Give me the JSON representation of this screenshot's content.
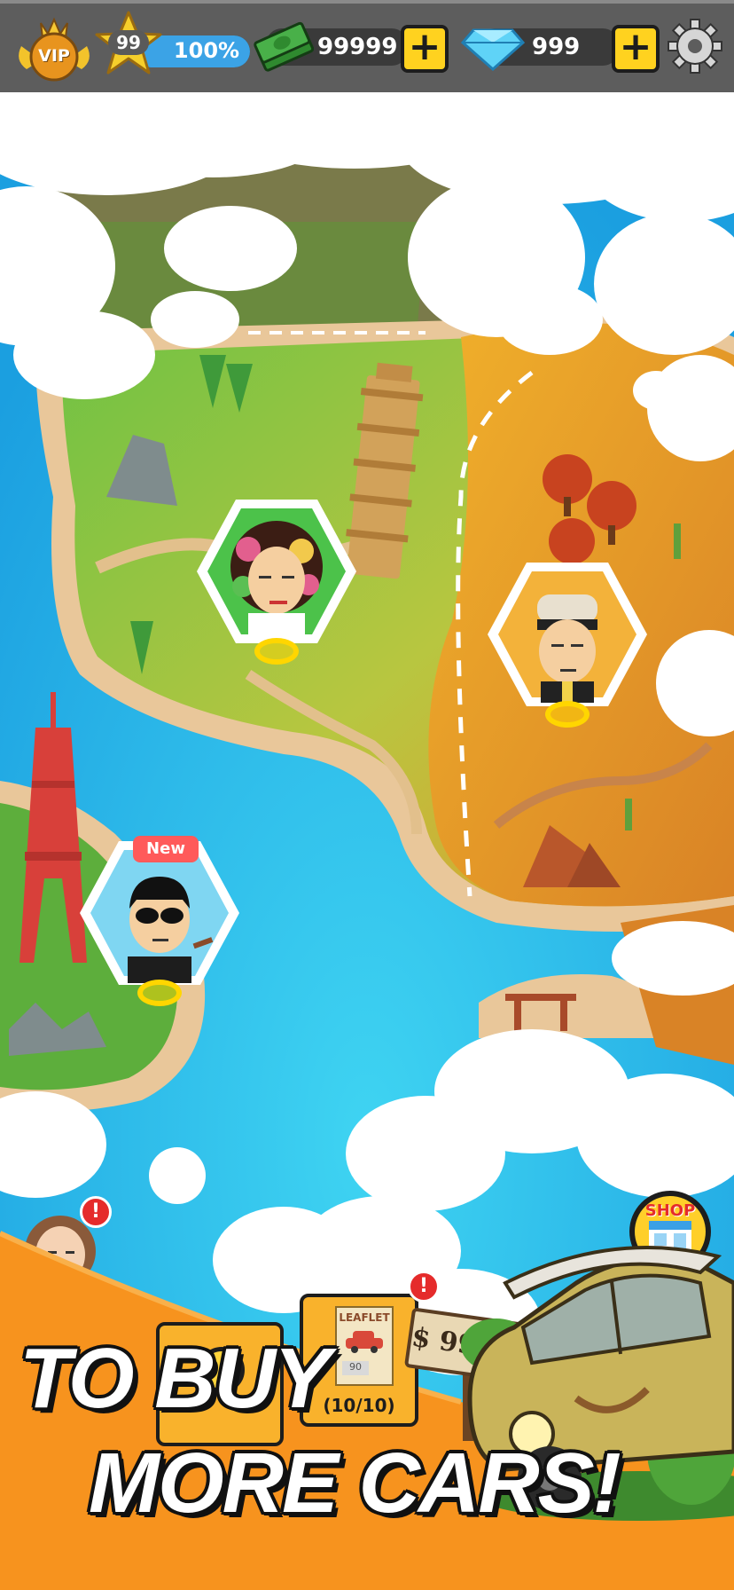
{
  "hud": {
    "vip_label": "VIP",
    "level": "99",
    "progress_text": "100%",
    "progress_fraction": 1.0,
    "cash": "99999",
    "gems": "999"
  },
  "map": {
    "stages": [
      {
        "id": "italy",
        "character": "curly-hair-woman"
      },
      {
        "id": "desert",
        "character": "headband-man"
      },
      {
        "id": "paris",
        "character": "sunglasses-man",
        "badge": "New"
      }
    ],
    "notification_mark": "!"
  },
  "shop": {
    "label": "SHOP"
  },
  "leaflet": {
    "title": "LEAFLET",
    "price_tag": "90",
    "count": "(10/10)"
  },
  "sign": {
    "price": "$ 999,99"
  },
  "promo": {
    "line1": "TO BUY",
    "line2": "MORE CARS!"
  },
  "colors": {
    "hud_bg": "#5d5d5d",
    "accent_yellow": "#ffd21f",
    "sea": "#2ab6e6",
    "promo_orange": "#f7931e",
    "progress_blue": "#3ba3e6"
  }
}
